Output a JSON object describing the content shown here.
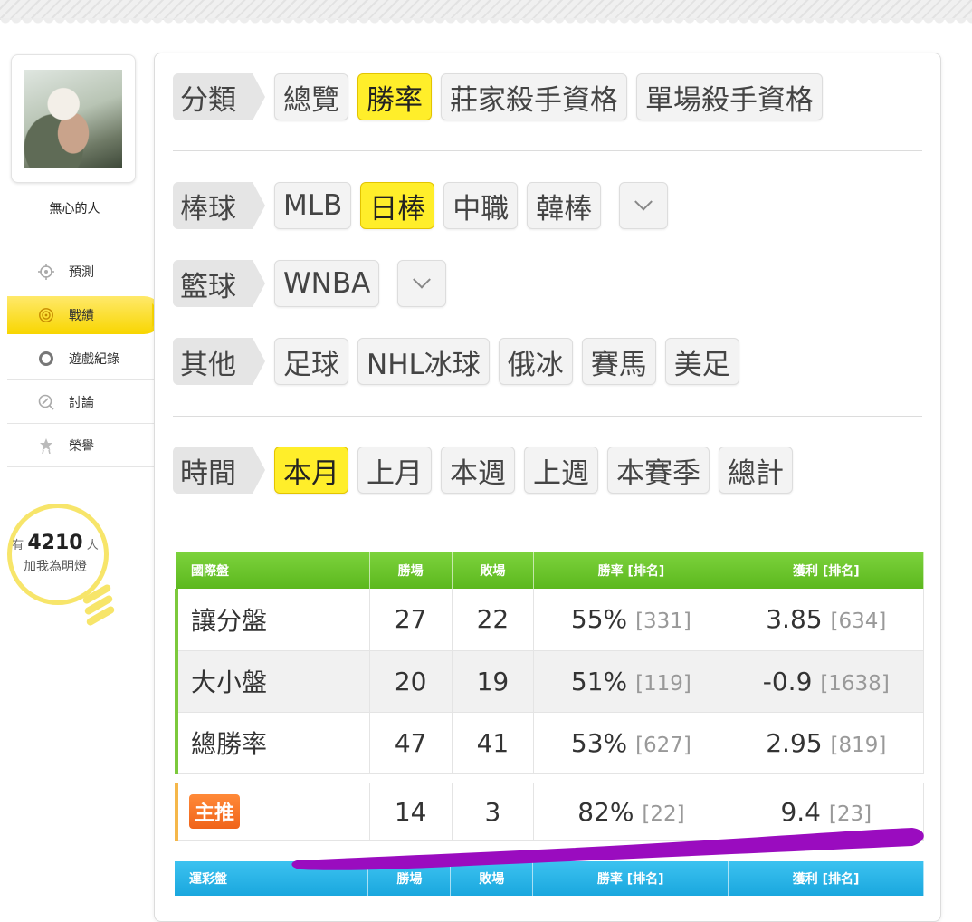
{
  "sidebar": {
    "username": "無心的人",
    "nav": [
      {
        "label": "預測",
        "icon": "crosshair-icon",
        "active": false
      },
      {
        "label": "戰績",
        "icon": "target-icon",
        "active": true
      },
      {
        "label": "遊戲紀錄",
        "icon": "circle-icon",
        "active": false
      },
      {
        "label": "討論",
        "icon": "discussion-icon",
        "active": false
      },
      {
        "label": "榮譽",
        "icon": "medal-icon",
        "active": false
      }
    ],
    "followers": {
      "prefix": "有",
      "count": "4210",
      "suffix": "人",
      "caption": "加我為明燈"
    }
  },
  "filters": {
    "category": {
      "label": "分類",
      "options": [
        "總覽",
        "勝率",
        "莊家殺手資格",
        "單場殺手資格"
      ],
      "selected": "勝率"
    },
    "baseball": {
      "label": "棒球",
      "options": [
        "MLB",
        "日棒",
        "中職",
        "韓棒"
      ],
      "selected": "日棒"
    },
    "basketball": {
      "label": "籃球",
      "options": [
        "WNBA"
      ],
      "selected": ""
    },
    "other": {
      "label": "其他",
      "options": [
        "足球",
        "NHL冰球",
        "俄冰",
        "賽馬",
        "美足"
      ],
      "selected": ""
    },
    "time": {
      "label": "時間",
      "options": [
        "本月",
        "上月",
        "本週",
        "上週",
        "本賽季",
        "總計"
      ],
      "selected": "本月"
    }
  },
  "intl_table": {
    "headers": [
      "國際盤",
      "勝場",
      "敗場",
      "勝率 [排名]",
      "獲利 [排名]"
    ],
    "rows": [
      {
        "name": "讓分盤",
        "win": "27",
        "loss": "22",
        "rate": "55%",
        "rate_rank": "[331]",
        "profit": "3.85",
        "profit_rank": "[634]"
      },
      {
        "name": "大小盤",
        "win": "20",
        "loss": "19",
        "rate": "51%",
        "rate_rank": "[119]",
        "profit": "-0.9",
        "profit_rank": "[1638]"
      },
      {
        "name": "總勝率",
        "win": "47",
        "loss": "41",
        "rate": "53%",
        "rate_rank": "[627]",
        "profit": "2.95",
        "profit_rank": "[819]"
      }
    ],
    "main_pick": {
      "name": "主推",
      "win": "14",
      "loss": "3",
      "rate": "82%",
      "rate_rank": "[22]",
      "profit": "9.4",
      "profit_rank": "[23]"
    }
  },
  "lottery_table": {
    "headers": [
      "運彩盤",
      "勝場",
      "敗場",
      "勝率 [排名]",
      "獲利 [排名]"
    ]
  },
  "colors": {
    "accent_yellow": "#ffee2a",
    "intl_header": "#6cc52d",
    "lottery_header": "#23b0e3",
    "main_badge": "#f0641a",
    "scribble": "#9a0cbf"
  }
}
